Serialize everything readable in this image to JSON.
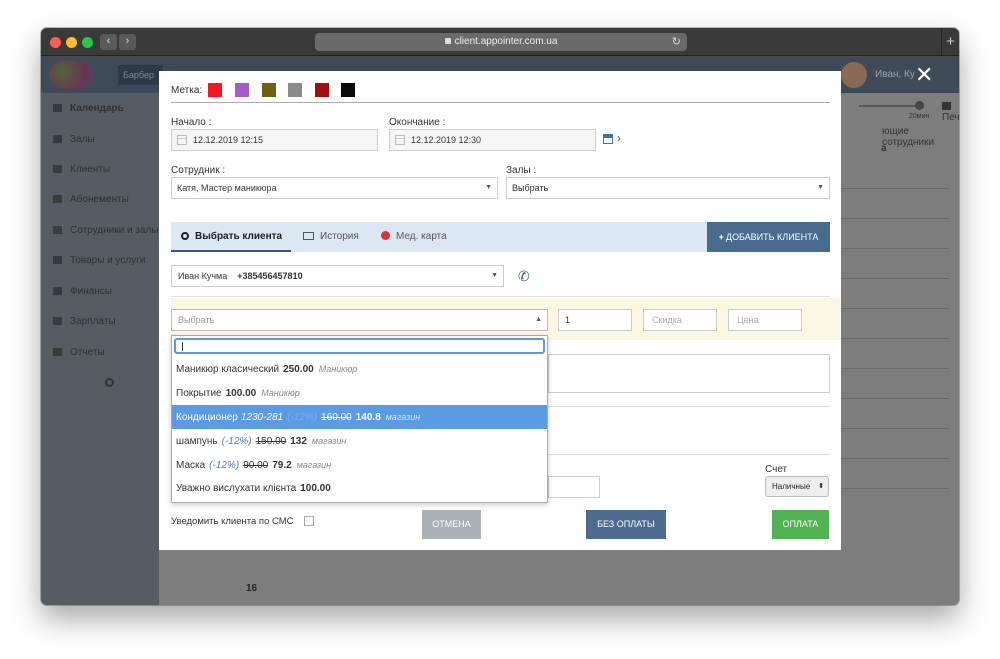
{
  "browser": {
    "url": "client.appointer.com.ua",
    "back_glyph": "‹",
    "forward_glyph": "›",
    "reload_glyph": "↻",
    "new_tab_glyph": "+"
  },
  "app": {
    "brand_chip": "Барбер",
    "user_name": "Иван, Ку",
    "sidebar": [
      "Календарь",
      "Залы",
      "Клиенты",
      "Абонементы",
      "Сотрудники и залы",
      "Товары и услуги",
      "Финансы",
      "Зарплаты",
      "Отчеты"
    ],
    "print_label": "Печать",
    "zoom_label": "20мин",
    "staff_label": "ющие сотрудники",
    "col_letter": "а",
    "day_label": "16"
  },
  "modal": {
    "close_glyph": "✕",
    "label_tag": "Метка:",
    "swatches": [
      "#f2191e",
      "#a45cc9",
      "#6d6214",
      "#8b8b8b",
      "#a00f0f",
      "#0a0a0a"
    ],
    "start_label": "Начало :",
    "start_value": "12.12.2019 12:15",
    "end_label": "Окончание :",
    "end_value": "12.12.2019 12:30",
    "next_glyph": "›",
    "employee_label": "Сотрудник :",
    "employee_value": "Катя, Мастер маникюра",
    "halls_label": "Залы :",
    "halls_value": "Выбрать",
    "tabs": [
      {
        "label": "Выбрать клиента",
        "icon": "search-icon"
      },
      {
        "label": "История",
        "icon": "id-card-icon"
      },
      {
        "label": "Мед. карта",
        "icon": "plus-circle-icon"
      }
    ],
    "add_client": "ДОБАВИТЬ КЛИЕНТА",
    "client_name": "Иван Кучма",
    "client_phone": "+385456457810",
    "service_placeholder": "Выбрать",
    "quantity": "1",
    "discount_placeholder": "Скидка",
    "price_placeholder": "Цена",
    "options": [
      {
        "name": "Маникюр класический",
        "price": "250.00",
        "cat": "Маникюр"
      },
      {
        "name": "Покрытие",
        "price": "100.00",
        "cat": "Маникюр"
      },
      {
        "name": "Кондиционер",
        "code": "1230-281",
        "disc": "(-12%)",
        "old": "160.00",
        "price": "140.8",
        "cat": "магазин"
      },
      {
        "name": "шампунь",
        "disc": "(-12%)",
        "old": "150.00",
        "price": "132",
        "cat": "магазин"
      },
      {
        "name": "Маска",
        "disc": "(-12%)",
        "old": "90.00",
        "price": "79.2",
        "cat": "магазин"
      },
      {
        "name": "Уважно вислухати клієнта",
        "price": "100.00",
        "cat": ""
      }
    ],
    "account_label": "Счет",
    "account_value": "Наличные",
    "sms_label": "Уведомить клиента по СМС",
    "cancel": "ОТМЕНА",
    "no_payment": "БЕЗ ОПЛАТЫ",
    "payment": "ОПЛАТА"
  }
}
